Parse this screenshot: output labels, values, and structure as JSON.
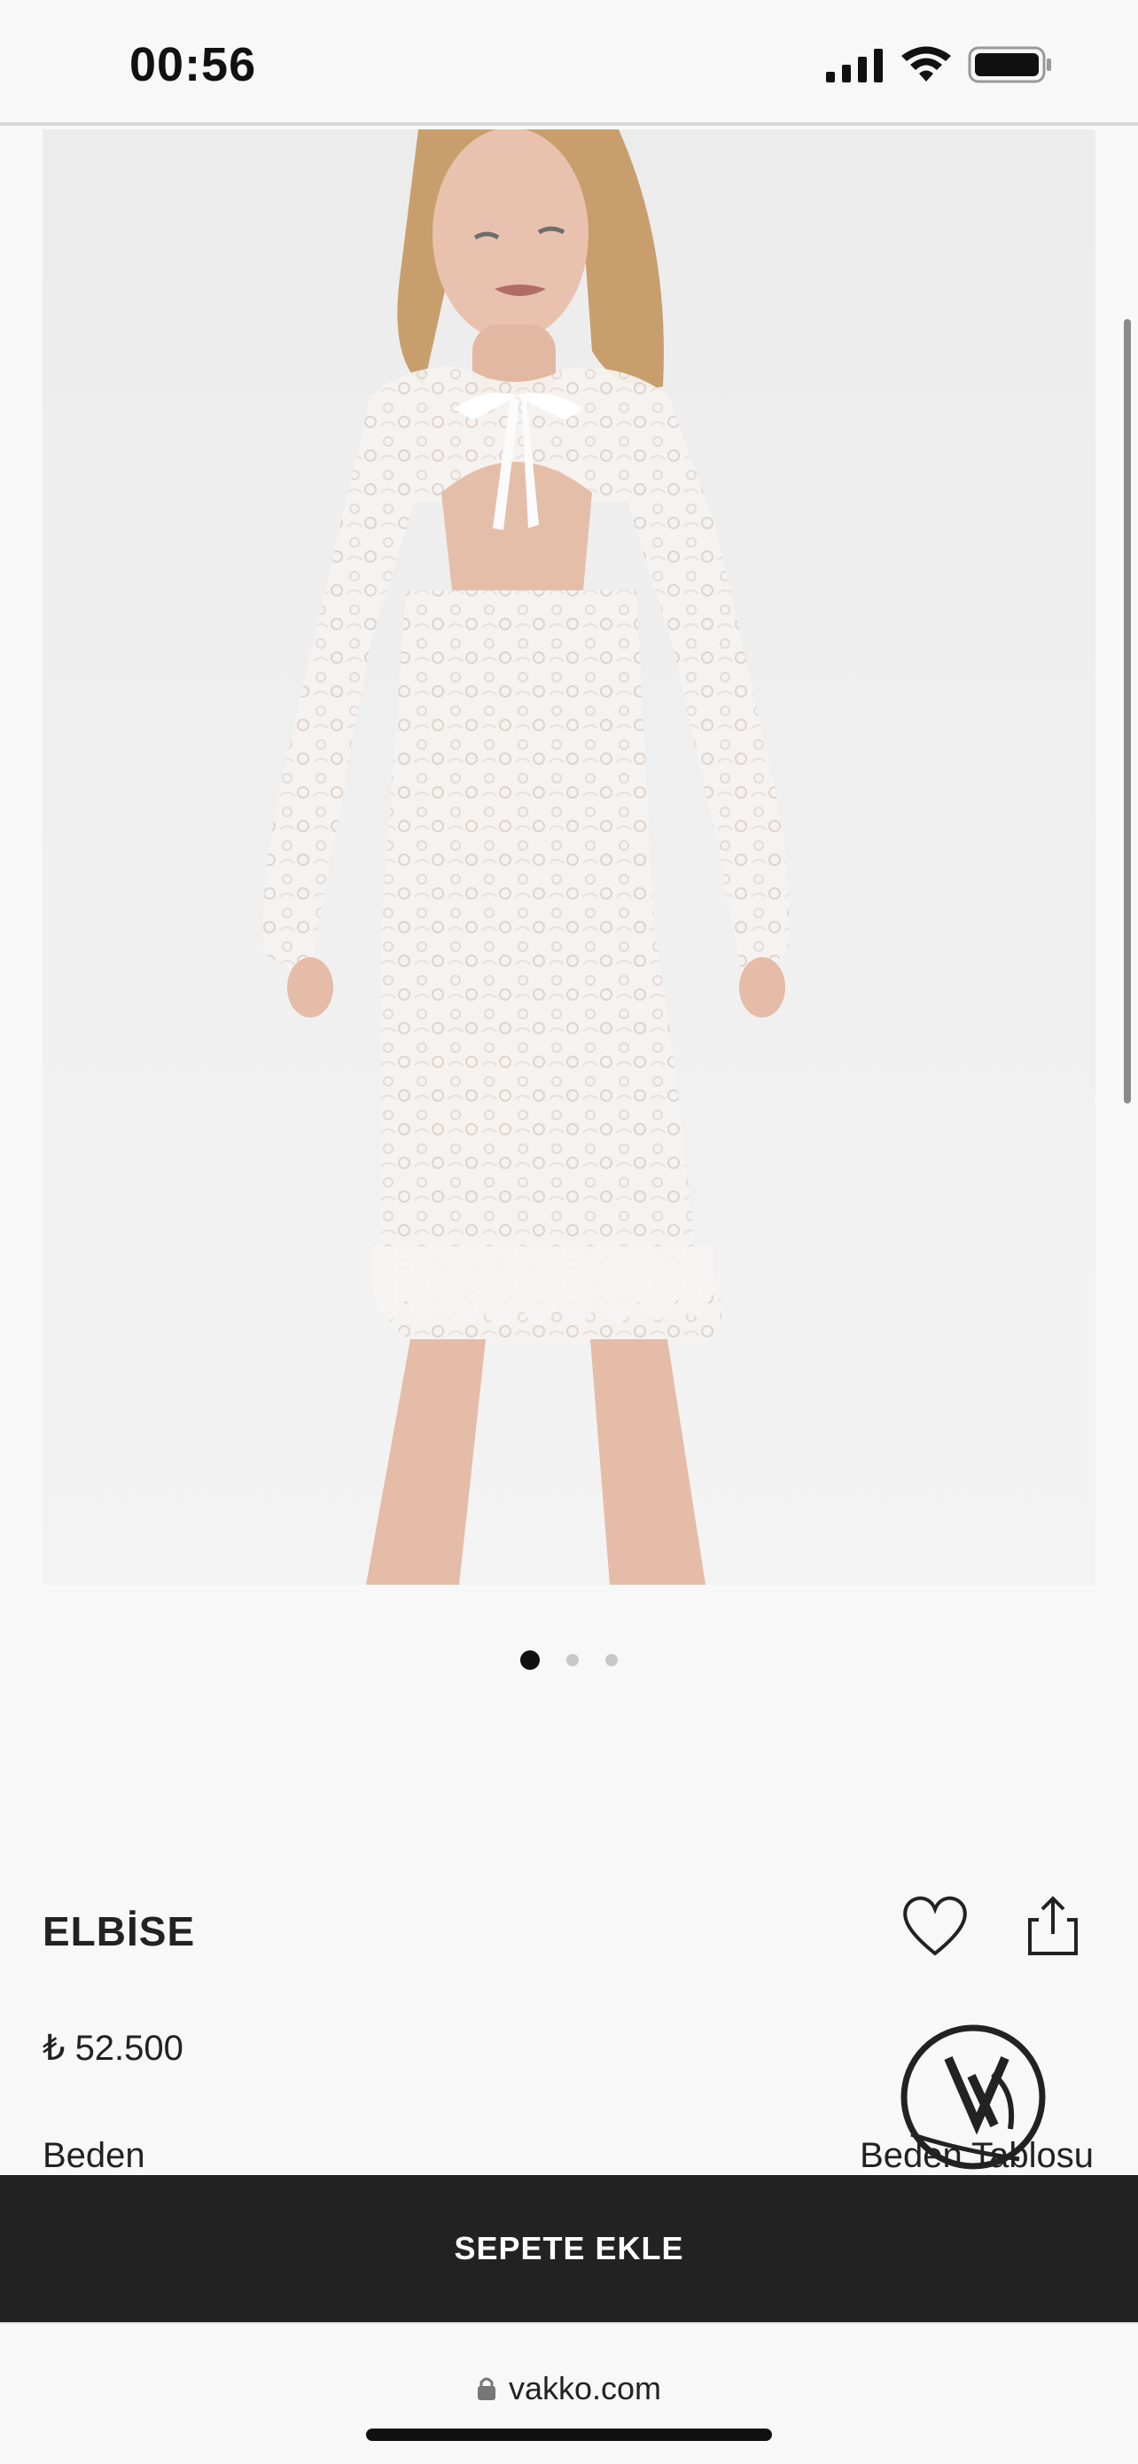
{
  "status_bar": {
    "time": "00:56"
  },
  "product": {
    "title": "ELBİSE",
    "price": "₺ 52.500",
    "image_alt": "white lace dress product photo"
  },
  "carousel": {
    "count": 3,
    "active_index": 0
  },
  "size": {
    "label": "Beden",
    "chart_link": "Beden Tablosu"
  },
  "cart": {
    "button_label": "SEPETE EKLE"
  },
  "browser": {
    "url": "vakko.com"
  },
  "icons": {
    "wishlist": "heart-icon",
    "share": "share-icon",
    "lock": "lock-icon",
    "signal": "signal-icon",
    "wifi": "wifi-icon",
    "battery": "battery-icon"
  }
}
